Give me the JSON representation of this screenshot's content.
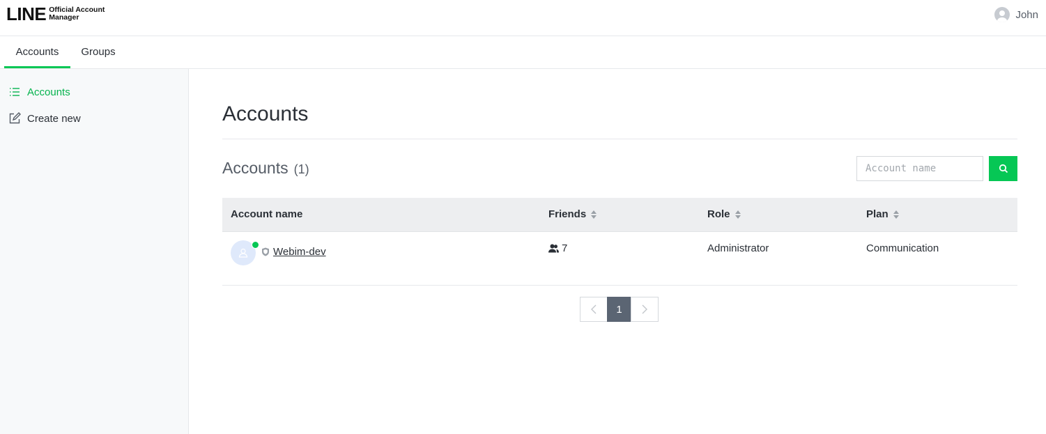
{
  "header": {
    "logo_main": "LINE",
    "logo_sub_1": "Official Account",
    "logo_sub_2": "Manager",
    "user_name": "John"
  },
  "tabs": [
    {
      "label": "Accounts",
      "active": true
    },
    {
      "label": "Groups",
      "active": false
    }
  ],
  "sidebar": {
    "items": [
      {
        "label": "Accounts",
        "icon": "list-icon",
        "active": true
      },
      {
        "label": "Create new",
        "icon": "edit-icon",
        "active": false
      }
    ]
  },
  "main": {
    "page_title": "Accounts",
    "section_title": "Accounts",
    "section_count": "(1)",
    "search_placeholder": "Account name"
  },
  "table": {
    "columns": [
      "Account name",
      "Friends",
      "Role",
      "Plan"
    ],
    "rows": [
      {
        "account_name": "Webim-dev",
        "friends": "7",
        "role": "Administrator",
        "plan": "Communication"
      }
    ]
  },
  "pagination": {
    "current": "1"
  },
  "colors": {
    "accent": "#06c755",
    "pager_active": "#5b6573"
  }
}
